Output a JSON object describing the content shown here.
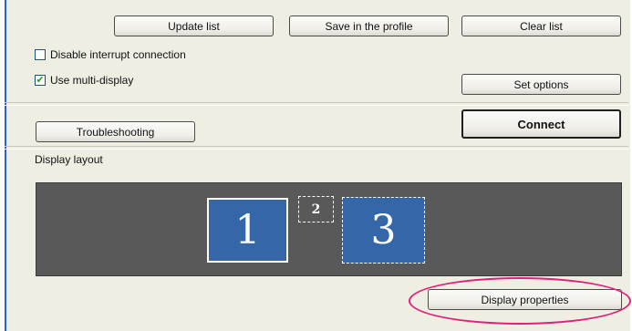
{
  "toolbar": {
    "update_list": "Update list",
    "save_profile": "Save in the profile",
    "clear_list": "Clear list"
  },
  "options": {
    "disable_interrupt": {
      "label": "Disable interrupt connection",
      "checked": false
    },
    "multi_display": {
      "label": "Use multi-display",
      "checked": true
    },
    "check_glyph": "✔"
  },
  "buttons": {
    "set_options": "Set options",
    "troubleshooting": "Troubleshooting",
    "connect": "Connect",
    "display_properties": "Display properties"
  },
  "layout": {
    "title": "Display layout",
    "monitors": [
      {
        "number": "1",
        "selected": true
      },
      {
        "number": "2",
        "selected": false
      },
      {
        "number": "3",
        "selected": false
      }
    ]
  },
  "colors": {
    "highlight": "#e0207a",
    "monitor_blue": "#3466a8",
    "layout_bg": "#595959"
  }
}
